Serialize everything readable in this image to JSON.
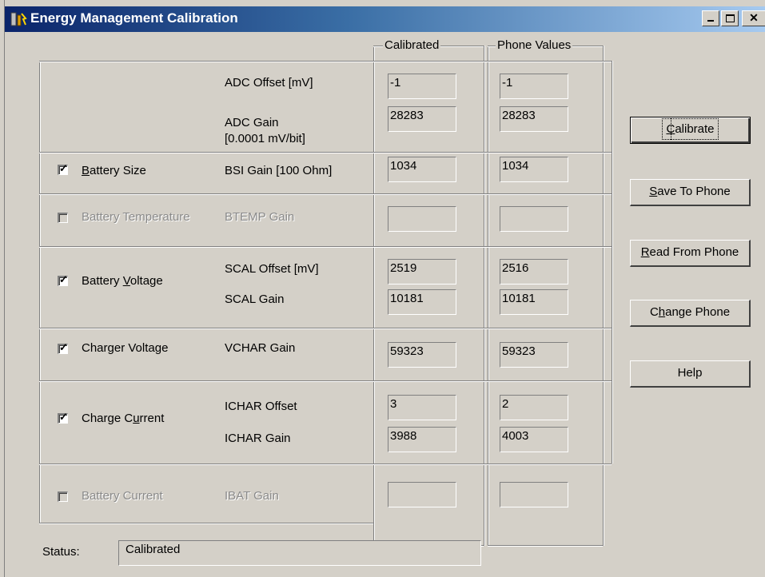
{
  "window": {
    "title": "Energy Management Calibration",
    "controls": [
      "minimize",
      "maximize",
      "close"
    ]
  },
  "columns": {
    "calibrated": "Calibrated",
    "phone_values": "Phone Values"
  },
  "rows": {
    "adc": {
      "param1": "ADC Offset [mV]",
      "param2_line1": "ADC Gain",
      "param2_line2": "[0.0001 mV/bit]",
      "cal1": "-1",
      "phone1": "-1",
      "cal2": "28283",
      "phone2": "28283"
    },
    "battery_size": {
      "label_prefix": "",
      "label_mnemonic": "B",
      "label_rest": "attery Size",
      "checked": true,
      "enabled": true,
      "param1": "BSI Gain [100 Ohm]",
      "cal1": "1034",
      "phone1": "1034"
    },
    "battery_temperature": {
      "label": "Battery Temperature",
      "checked": false,
      "enabled": false,
      "param1": "BTEMP Gain",
      "cal1": "",
      "phone1": ""
    },
    "battery_voltage": {
      "label_prefix": "Battery ",
      "label_mnemonic": "V",
      "label_rest": "oltage",
      "checked": true,
      "enabled": true,
      "param1": "SCAL Offset [mV]",
      "param2": "SCAL Gain",
      "cal1": "2519",
      "phone1": "2516",
      "cal2": "10181",
      "phone2": "10181"
    },
    "charger_voltage": {
      "label": "Charger Voltage",
      "checked": true,
      "enabled": true,
      "param1": "VCHAR Gain",
      "cal1": "59323",
      "phone1": "59323"
    },
    "charge_current": {
      "label_prefix": "Charge C",
      "label_mnemonic": "u",
      "label_rest": "rrent",
      "checked": true,
      "enabled": true,
      "param1": "ICHAR Offset",
      "param2": "ICHAR Gain",
      "cal1": "3",
      "phone1": "2",
      "cal2": "3988",
      "phone2": "4003"
    },
    "battery_current": {
      "label": "Battery Current",
      "checked": false,
      "enabled": false,
      "param1": "IBAT Gain",
      "cal1": "",
      "phone1": ""
    }
  },
  "buttons": {
    "calibrate": {
      "mnemonic": "C",
      "rest": "alibrate"
    },
    "save": {
      "mnemonic": "S",
      "rest": "ave To Phone"
    },
    "read": {
      "mnemonic": "R",
      "rest": "ead From Phone"
    },
    "change": {
      "prefix": "C",
      "mnemonic": "h",
      "rest": "ange Phone"
    },
    "help": {
      "label": "Help"
    }
  },
  "status": {
    "label": "Status:",
    "value": "Calibrated"
  }
}
